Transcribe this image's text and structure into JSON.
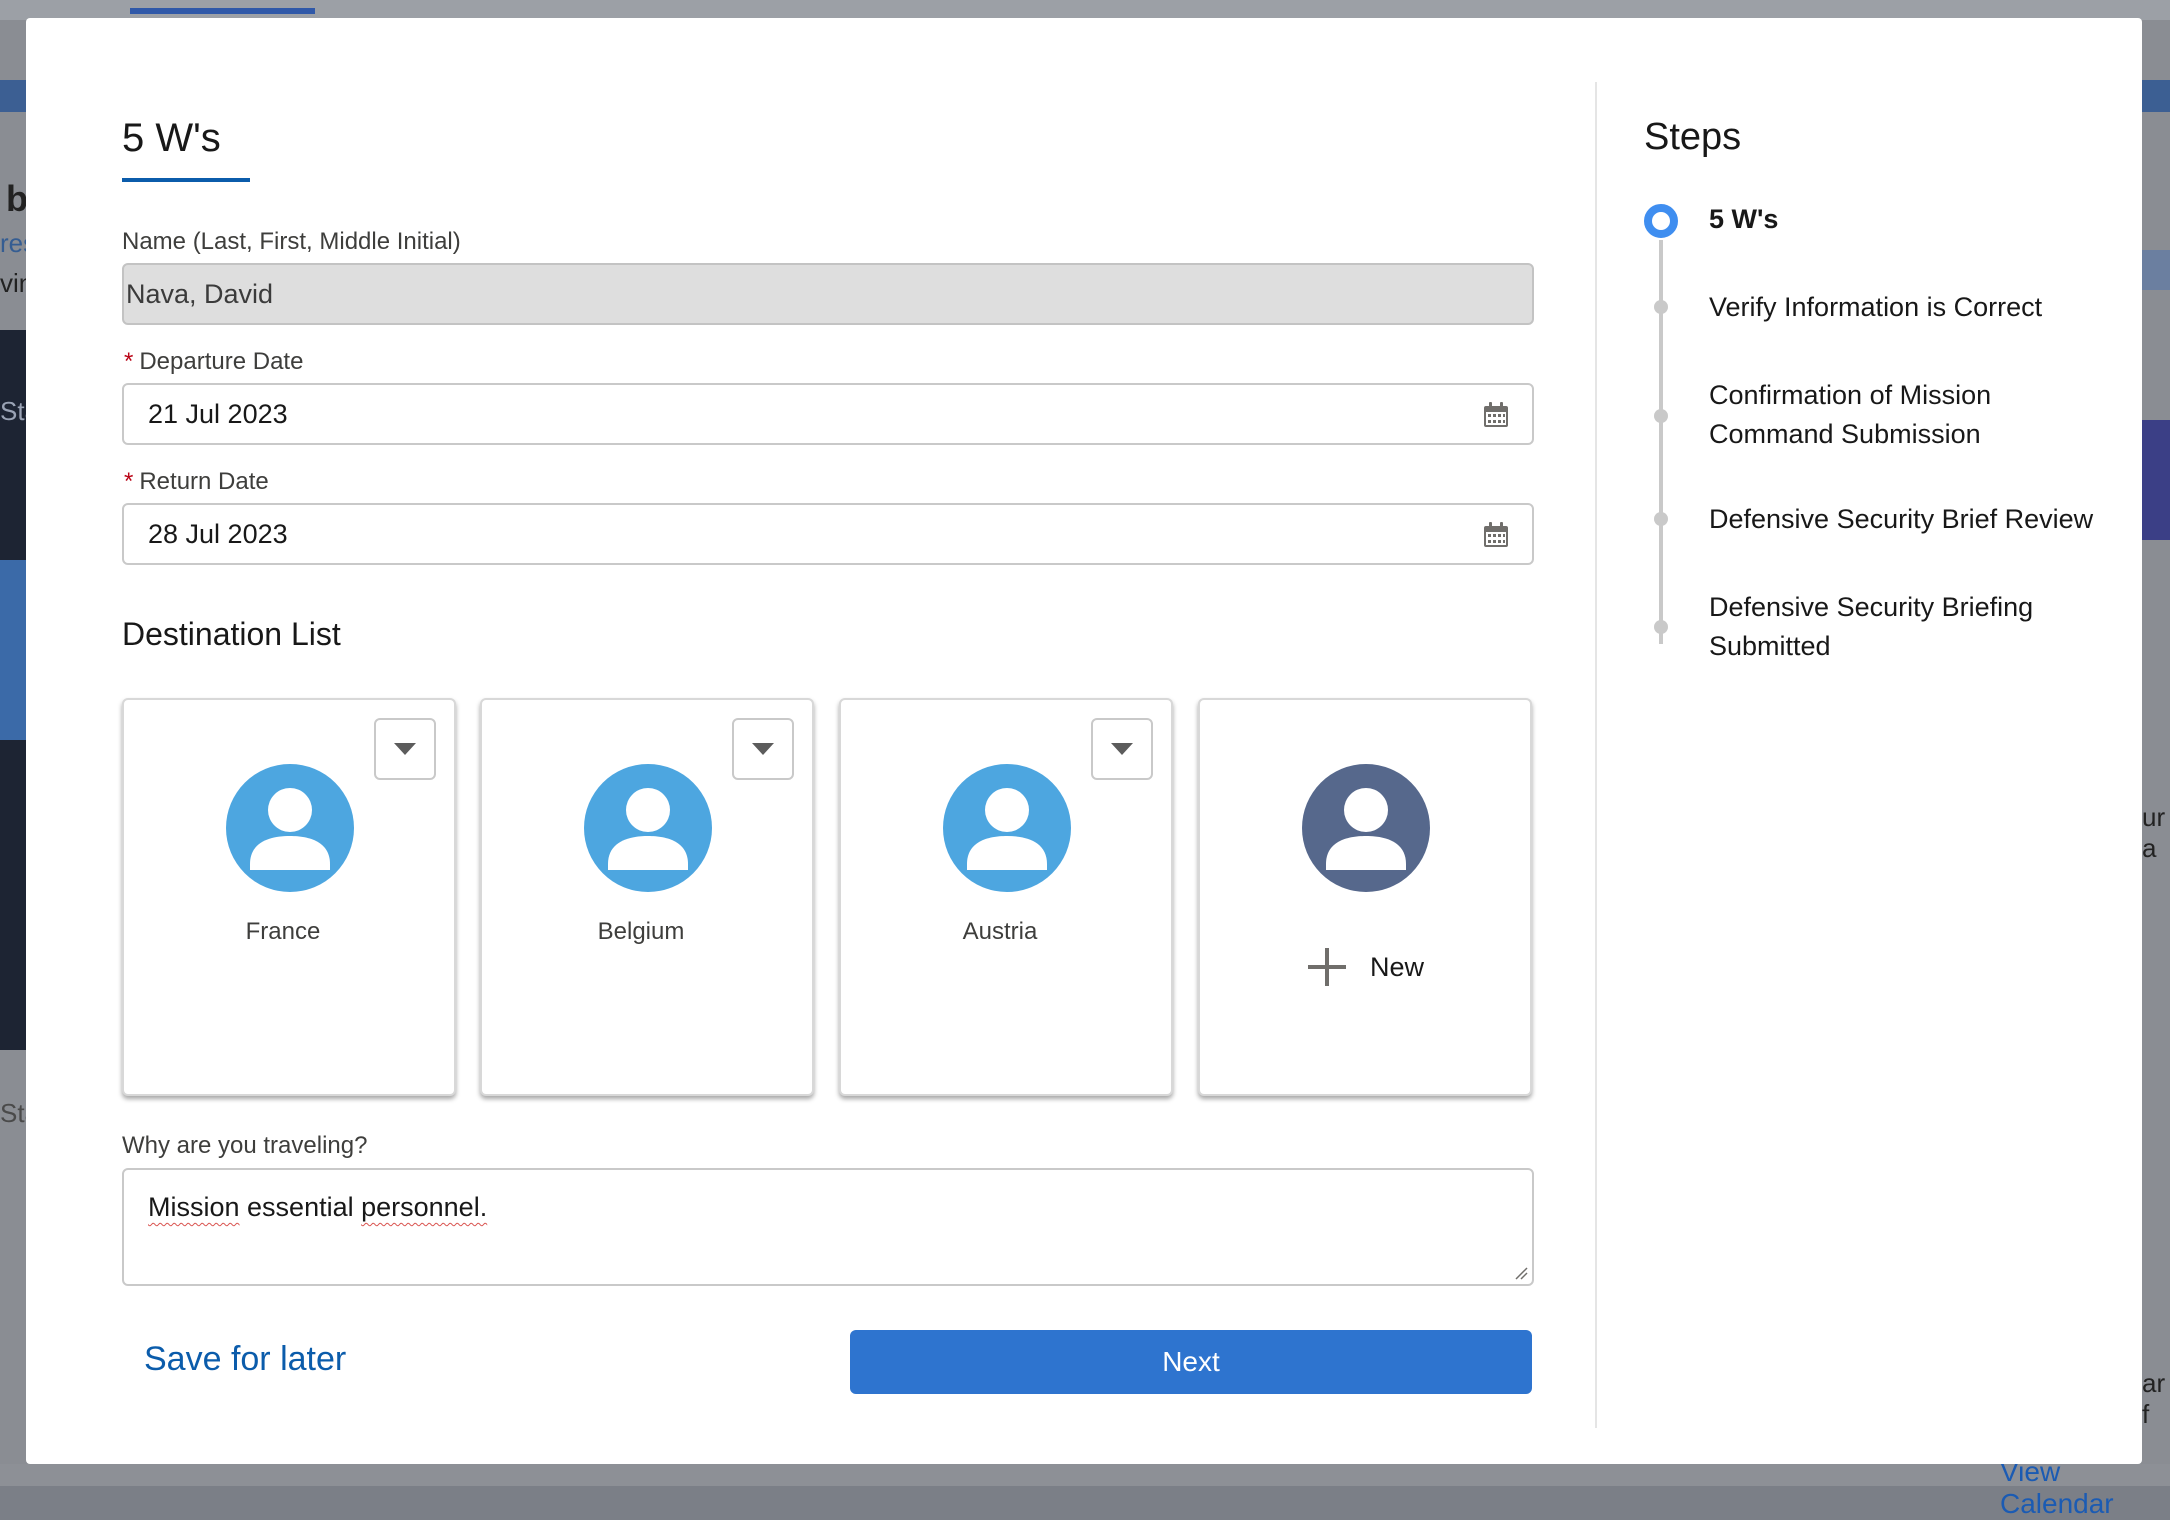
{
  "background": {
    "fragment_1": "b",
    "fragment_2": "res",
    "fragment_3": "vin",
    "fragment_4": "Sta",
    "fragment_5": "Sta",
    "fragment_6": "ur a",
    "fragment_7": "ar f",
    "view_calendar_link": "View Calendar"
  },
  "form": {
    "tab_title": "5 W's",
    "name_label": "Name (Last, First, Middle Initial)",
    "name_value": "Nava, David",
    "required_marker": "*",
    "departure_label": "Departure Date",
    "departure_value": "21 Jul 2023",
    "return_label": "Return Date",
    "return_value": "28 Jul 2023",
    "calendar_icon": "calendar-icon"
  },
  "destinations": {
    "title": "Destination List",
    "items": [
      {
        "label": "France",
        "icon": "user-avatar-icon"
      },
      {
        "label": "Belgium",
        "icon": "user-avatar-icon"
      },
      {
        "label": "Austria",
        "icon": "user-avatar-icon"
      }
    ],
    "new_label": "New",
    "colors": {
      "avatar": "#4da6e0",
      "new_avatar": "#56688c"
    }
  },
  "why": {
    "label": "Why are you traveling?",
    "value_part1": "Mission",
    "value_part2": " essential ",
    "value_part3": "personnel."
  },
  "footer": {
    "save_for_later": "Save for later",
    "next": "Next",
    "accent_color": "#2e74cf"
  },
  "steps": {
    "title": "Steps",
    "items": [
      {
        "label": "5 W's",
        "status": "current"
      },
      {
        "label": "Verify Information is Correct",
        "status": "upcoming"
      },
      {
        "label": "Confirmation of Mission Command Submission",
        "status": "upcoming"
      },
      {
        "label": "Defensive Security Brief Review",
        "status": "upcoming"
      },
      {
        "label": "Defensive Security Briefing Submitted",
        "status": "upcoming"
      }
    ]
  }
}
